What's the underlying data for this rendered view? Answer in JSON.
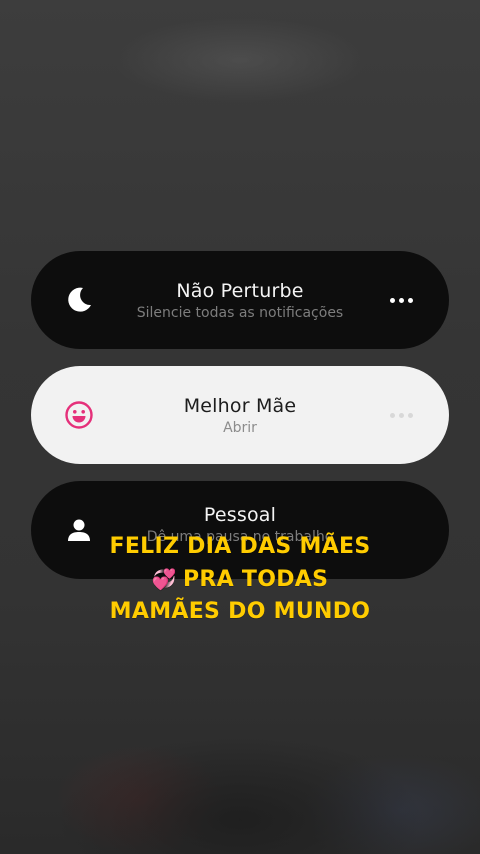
{
  "focus_modes": [
    {
      "title": "Não Perturbe",
      "subtitle": "Silencie todas as notificações",
      "icon": "moon-icon",
      "theme": "dark"
    },
    {
      "title": "Melhor Mãe",
      "subtitle": "Abrir",
      "icon": "smiley-face-icon",
      "icon_color": "#e5307a",
      "theme": "light"
    },
    {
      "title": "Pessoal",
      "subtitle": "Dê uma pausa no trabalho",
      "icon": "person-icon",
      "theme": "dark"
    }
  ],
  "caption": {
    "line1": "FELIZ DIA DAS MÃES",
    "line2_emoji": "💞",
    "line2": "PRA TODAS",
    "line3": "MAMÃES DO MUNDO",
    "color": "#ffcc00"
  }
}
